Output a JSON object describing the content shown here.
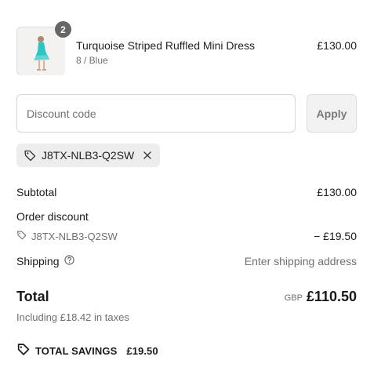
{
  "line_item": {
    "quantity": "2",
    "title": "Turquoise Striped Ruffled Mini Dress",
    "variant": "8 / Blue",
    "price": "£130.00",
    "image_icon": "dress-product-photo"
  },
  "discount": {
    "placeholder": "Discount code",
    "value": "",
    "apply_label": "Apply",
    "applied_code": "J8TX-NLB3-Q2SW",
    "tag_icon": "tag-icon",
    "remove_icon": "close-icon"
  },
  "summary": {
    "subtotal_label": "Subtotal",
    "subtotal_value": "£130.00",
    "order_discount_label": "Order discount",
    "discount_code": "J8TX-NLB3-Q2SW",
    "discount_value": "− £19.50",
    "shipping_label": "Shipping",
    "shipping_icon": "help-circle-icon",
    "shipping_value": "Enter shipping address",
    "total_label": "Total",
    "currency": "GBP",
    "total_value": "£110.50",
    "taxes_note": "Including £18.42 in taxes",
    "savings_icon": "tag-icon",
    "savings_label": "TOTAL SAVINGS",
    "savings_value": "£19.50"
  },
  "colors": {
    "badge": "#666666",
    "muted_text": "#707070",
    "dress": "#2ec4c4"
  }
}
